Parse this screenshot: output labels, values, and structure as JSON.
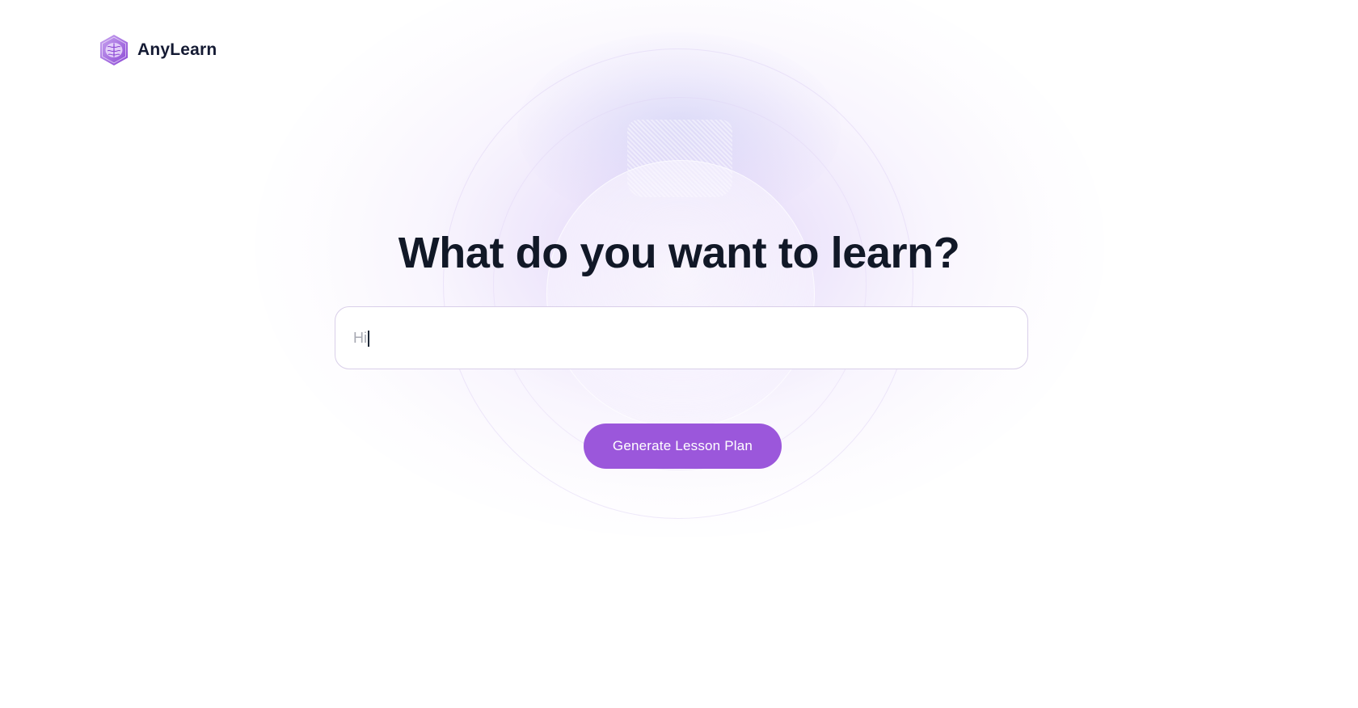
{
  "brand": {
    "name": "AnyLearn",
    "logo_icon": "brain-hexagon-icon",
    "accent_color": "#9b57db"
  },
  "hero": {
    "title": "What do you want to learn?"
  },
  "search": {
    "value": "Hi",
    "placeholder": ""
  },
  "actions": {
    "generate_label": "Generate Lesson Plan"
  }
}
